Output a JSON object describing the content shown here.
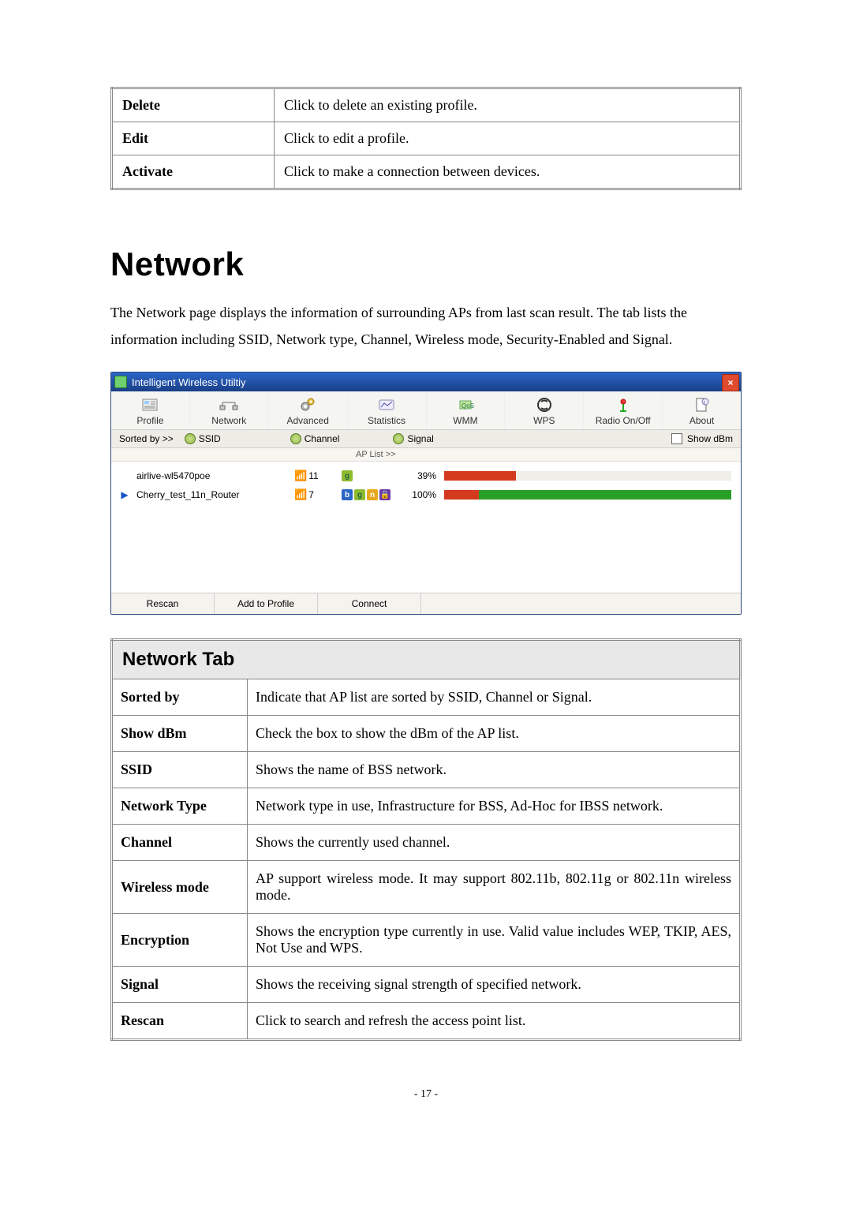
{
  "top_table": {
    "rows": [
      {
        "label": "Delete",
        "desc": "Click to delete an existing profile."
      },
      {
        "label": "Edit",
        "desc": "Click to edit a profile."
      },
      {
        "label": "Activate",
        "desc": "Click to make a connection between devices."
      }
    ]
  },
  "heading": "Network",
  "intro": "The Network page displays the information of surrounding APs from last scan result. The tab lists the information including SSID, Network type, Channel, Wireless mode, Security-Enabled and Signal.",
  "window": {
    "title": "Intelligent Wireless Utiltiy",
    "close": "×",
    "tabs": [
      "Profile",
      "Network",
      "Advanced",
      "Statistics",
      "WMM",
      "WPS",
      "Radio On/Off",
      "About"
    ],
    "sortbar": {
      "label": "Sorted by >>",
      "options": [
        "SSID",
        "Channel",
        "Signal"
      ],
      "right_checkbox": "Show dBm"
    },
    "aplist_label": "AP List >>",
    "rows": [
      {
        "arrow": "",
        "ssid": "airlive-wl5470poe",
        "channel": "11",
        "modes": [
          "g"
        ],
        "lock": false,
        "percent": "39%",
        "bar_pct": 39,
        "bar_color": "#d43a1d"
      },
      {
        "arrow": "▶",
        "ssid": "Cherry_test_11n_Router",
        "channel": "7",
        "modes": [
          "b",
          "g",
          "n"
        ],
        "lock": true,
        "percent": "100%",
        "bar_pct": 100,
        "bar_color": "#2aa02a",
        "bar_color2": "#d43a1d"
      }
    ],
    "buttons": [
      "Rescan",
      "Add to Profile",
      "Connect"
    ]
  },
  "net_table": {
    "title": "Network Tab",
    "rows": [
      {
        "label": "Sorted by",
        "desc": "Indicate that AP list are sorted by SSID, Channel or Signal."
      },
      {
        "label": "Show dBm",
        "desc": "Check the box to show the dBm of the AP list."
      },
      {
        "label": "SSID",
        "desc": "Shows the name of BSS network."
      },
      {
        "label": "Network Type",
        "desc": "Network type in use, Infrastructure for BSS, Ad-Hoc for IBSS network."
      },
      {
        "label": "Channel",
        "desc": "Shows the currently used channel."
      },
      {
        "label": "Wireless mode",
        "desc": "AP support wireless mode. It may support 802.11b, 802.11g or 802.11n wireless mode.",
        "justify": true
      },
      {
        "label": "Encryption",
        "desc": "Shows the encryption type currently in use. Valid value includes WEP, TKIP, AES, Not Use and WPS.",
        "justify": true
      },
      {
        "label": "Signal",
        "desc": "Shows the receiving signal strength of specified network."
      },
      {
        "label": "Rescan",
        "desc": "Click to search and refresh the access point list."
      }
    ]
  },
  "page_number": "- 17 -"
}
